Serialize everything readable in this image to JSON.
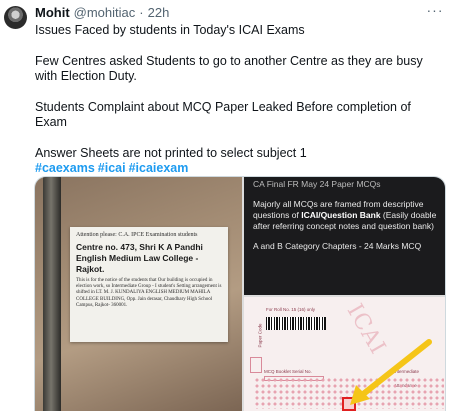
{
  "tweet": {
    "author_name": "Mohit",
    "author_handle": "@mohitiac",
    "separator": "·",
    "time": "22h",
    "more_label": "···",
    "lines": [
      "Issues Faced by students in Today's ICAI Exams",
      "Few Centres asked Students to go to another Centre as they are busy with Election Duty.",
      "Students Complaint about MCQ Paper Leaked Before completion of Exam",
      "Answer Sheets are not printed to select subject 1"
    ],
    "hashtags": [
      "#caexams",
      "#icai",
      "#icaiexam"
    ]
  },
  "media": {
    "notice": {
      "attention": "Attention please: C.A. IPCE Examination students",
      "title_line1": "Centre no. 473, Shri K A Pandhi",
      "title_line2": "English Medium Law College - Rajkot.",
      "body": "This is for the notice of the students that Our building is occupied in election work, so Intermediate Group - I student's Setting arrangement is shifted in LT. M. J. KUNDALIYA ENGLISH MEDIUM MAHILA COLLEGE BUILDING, Opp. Jain derasar, Chaudhary High School Campus, Rajkot- 360001."
    },
    "panel": {
      "header": "CA Final FR May 24 Paper MCQs",
      "para1_prefix": "Majorly all MCQs are framed from descriptive questions of ",
      "para1_bold": "ICAI/Question Bank",
      "para1_suffix": " (Easily doable after referring concept notes and question bank)",
      "para2": "A and B Category Chapters - 24 Marks MCQ"
    },
    "sheet": {
      "watermark": "ICAI",
      "label_roll": "For Roll No. 15 (16) only",
      "label_paper": "Paper Code",
      "label_booklet": "MCQ Booklet Serial No.",
      "label_register": "Intermediate",
      "label_attendance": "Attendance",
      "arrow_color": "#f5c518",
      "mark_color": "#e02020"
    }
  },
  "colors": {
    "text": "#0f1419",
    "muted": "#536471",
    "link": "#1d9bf0"
  }
}
